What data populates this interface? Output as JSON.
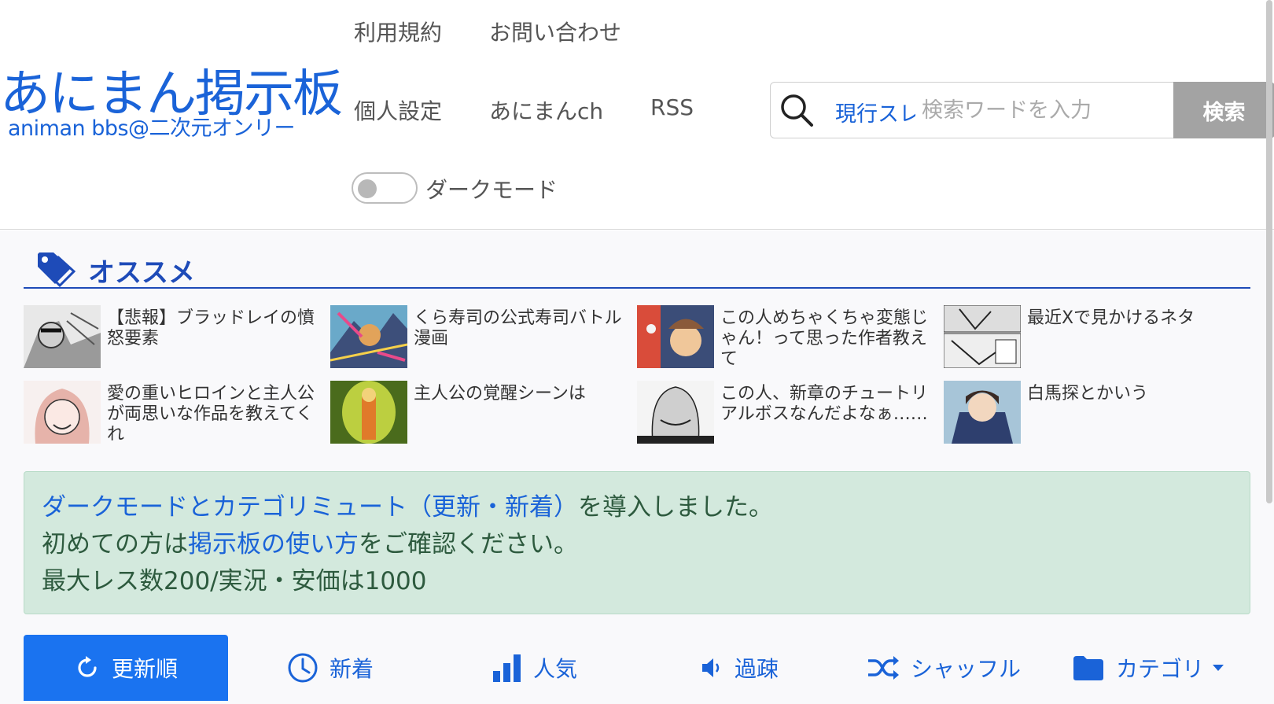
{
  "logo": {
    "title": "あにまん掲示板",
    "subtitle": "animan bbs@二次元オンリー"
  },
  "nav": {
    "terms": "利用規約",
    "contact": "お問い合わせ",
    "settings": "個人設定",
    "animanch": "あにまんch",
    "rss": "RSS"
  },
  "search": {
    "scope": "現行スレ",
    "placeholder": "検索ワードを入力",
    "button": "検索"
  },
  "dark_mode": {
    "label": "ダークモード",
    "enabled": false
  },
  "recommend": {
    "title": "オススメ",
    "items": [
      {
        "title": "【悲報】ブラッドレイの憤怒要素"
      },
      {
        "title": "くら寿司の公式寿司バトル漫画"
      },
      {
        "title": "この人めちゃくちゃ変態じゃん！って思った作者教えて"
      },
      {
        "title": "最近Xで見かけるネタ"
      },
      {
        "title": "愛の重いヒロインと主人公が両思いな作品を教えてくれ"
      },
      {
        "title": "主人公の覚醒シーンは"
      },
      {
        "title": "この人、新章のチュートリアルボスなんだよなぁ……"
      },
      {
        "title": "白馬探とかいう"
      }
    ]
  },
  "notice": {
    "line1_link": "ダークモードとカテゴリミュート（更新・新着）",
    "line1_text": "を導入しました。",
    "line2_pre": "初めての方は",
    "line2_link": "掲示板の使い方",
    "line2_post": "をご確認ください。",
    "line3": "最大レス数200/実況・安価は1000"
  },
  "tabs": [
    {
      "label": "更新順",
      "icon": "refresh-icon",
      "active": true
    },
    {
      "label": "新着",
      "icon": "clock-icon",
      "active": false
    },
    {
      "label": "人気",
      "icon": "bar-chart-icon",
      "active": false
    },
    {
      "label": "過疎",
      "icon": "speaker-icon",
      "active": false
    },
    {
      "label": "シャッフル",
      "icon": "shuffle-icon",
      "active": false
    },
    {
      "label": "カテゴリ",
      "icon": "folder-icon",
      "active": false
    }
  ],
  "colors": {
    "brand": "#1a63d8",
    "active_tab": "#1a73f0",
    "notice_bg": "#d3e9dd",
    "section": "#1e4bb8"
  }
}
